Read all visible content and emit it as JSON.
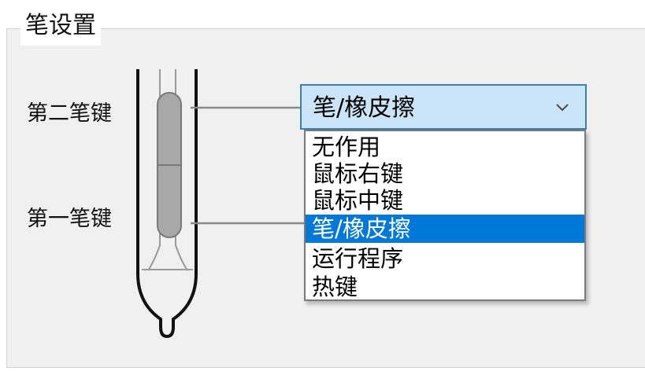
{
  "group": {
    "title": "笔设置"
  },
  "pen": {
    "upper_button_label": "第二笔键",
    "lower_button_label": "第一笔键"
  },
  "combo": {
    "value": "笔/橡皮擦",
    "arrow_icon": "chevron-down-icon"
  },
  "dropdown": {
    "items": [
      {
        "label": "无作用",
        "selected": false
      },
      {
        "label": "鼠标右键",
        "selected": false
      },
      {
        "label": "鼠标中键",
        "selected": false
      },
      {
        "label": "笔/橡皮擦",
        "selected": true
      },
      {
        "label": "运行程序",
        "selected": false
      },
      {
        "label": "热键",
        "selected": false
      }
    ]
  },
  "colors": {
    "selection": "#0078d7",
    "combo_focus_bg": "#cce4f7",
    "combo_border": "#3c7fb1"
  }
}
